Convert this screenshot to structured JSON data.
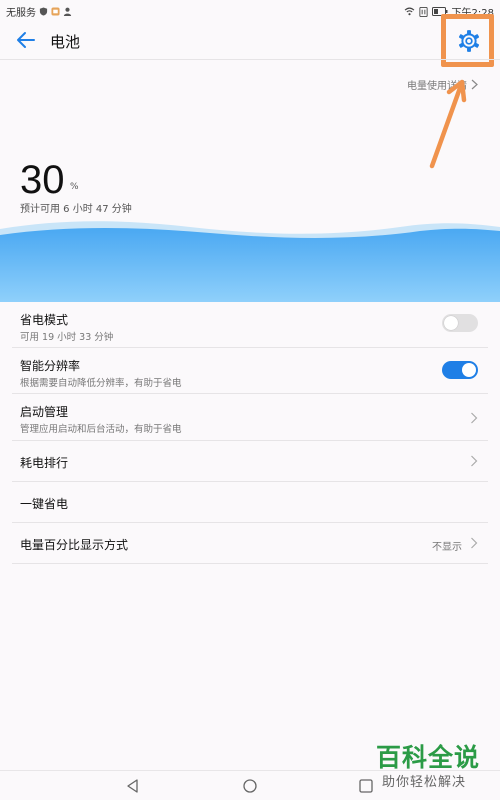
{
  "status_bar": {
    "carrier": "无服务",
    "time": "下午2:28"
  },
  "app_bar": {
    "title": "电池",
    "back_icon": "back-arrow-icon",
    "settings_icon": "gear-icon"
  },
  "usage_link": {
    "label": "电量使用详情"
  },
  "battery": {
    "level": "30",
    "unit": "%",
    "estimate": "预计可用 6 小时 47 分钟"
  },
  "settings": {
    "power_saving": {
      "title": "省电模式",
      "subtitle": "可用 19 小时 33 分钟",
      "enabled": false
    },
    "smart_resolution": {
      "title": "智能分辨率",
      "subtitle": "根据需要自动降低分辨率，有助于省电",
      "enabled": true
    },
    "startup": {
      "title": "启动管理",
      "subtitle": "管理应用启动和后台活动，有助于省电"
    },
    "consumption_rank": {
      "title": "耗电排行"
    },
    "one_key_save": {
      "title": "一键省电"
    },
    "percent_display": {
      "title": "电量百分比显示方式",
      "value": "不显示"
    }
  },
  "watermark": {
    "title": "百科全说",
    "subtitle": "助你轻松解决"
  },
  "colors": {
    "accent": "#1f7fe6",
    "highlight": "#f0934d",
    "wave_top": "#4aa8f2",
    "wave_bottom": "#8fd0fb",
    "watermark": "#2b9b46"
  }
}
